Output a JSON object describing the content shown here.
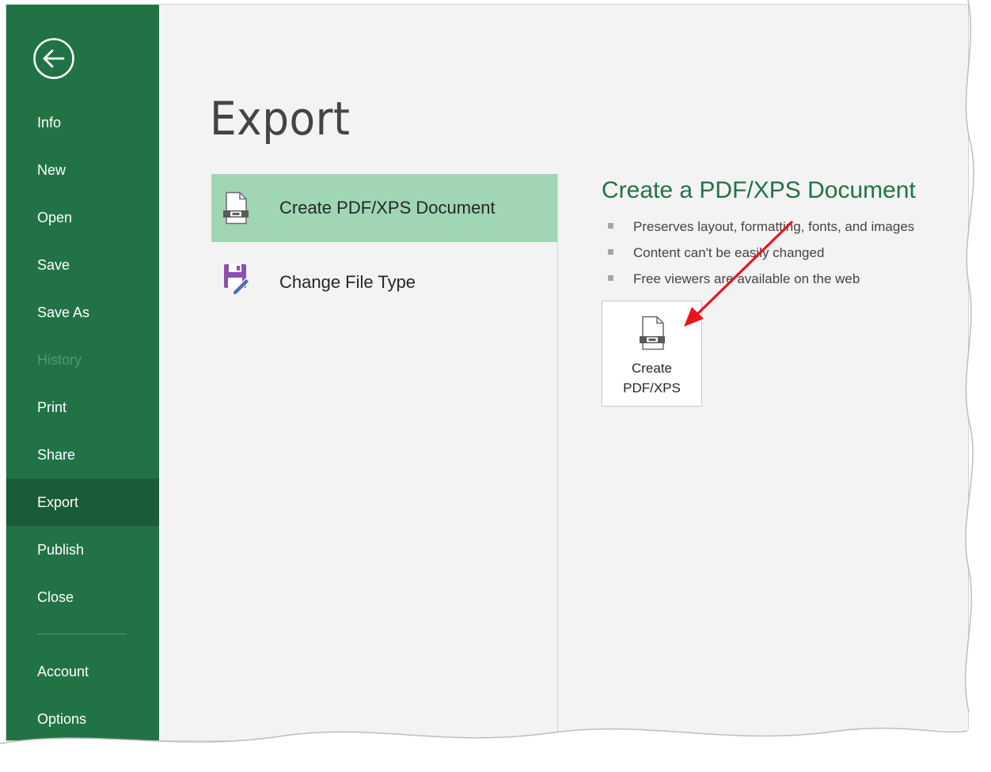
{
  "sidebar": {
    "back_icon": "back-arrow-circle-icon",
    "items": [
      {
        "id": "info",
        "label": "Info"
      },
      {
        "id": "new",
        "label": "New"
      },
      {
        "id": "open",
        "label": "Open"
      },
      {
        "id": "save",
        "label": "Save"
      },
      {
        "id": "save-as",
        "label": "Save As"
      },
      {
        "id": "history",
        "label": "History"
      },
      {
        "id": "print",
        "label": "Print"
      },
      {
        "id": "share",
        "label": "Share"
      },
      {
        "id": "export",
        "label": "Export"
      },
      {
        "id": "publish",
        "label": "Publish"
      },
      {
        "id": "close",
        "label": "Close"
      }
    ],
    "bottom_items": [
      {
        "id": "account",
        "label": "Account"
      },
      {
        "id": "options",
        "label": "Options"
      }
    ],
    "active": "Export",
    "disabled": "History"
  },
  "main": {
    "title": "Export",
    "options": [
      {
        "label": "Create PDF/XPS Document",
        "icon": "pdf-document-icon",
        "selected": true
      },
      {
        "label": "Change File Type",
        "icon": "save-edit-icon",
        "selected": false
      }
    ]
  },
  "detail": {
    "title": "Create a PDF/XPS Document",
    "bullets": [
      "Preserves layout, formatting, fonts, and images",
      "Content can't be easily changed",
      "Free viewers are available on the web"
    ],
    "button_line1": "Create",
    "button_line2": "PDF/XPS",
    "button_icon": "pdf-document-icon"
  },
  "colors": {
    "sidebar_bg": "#217346",
    "sidebar_active": "#1a5c38",
    "selected_option": "#a0d6b4",
    "accent_text": "#217346",
    "annotation_arrow": "#e8161b",
    "save_icon": "#8a52b0"
  }
}
